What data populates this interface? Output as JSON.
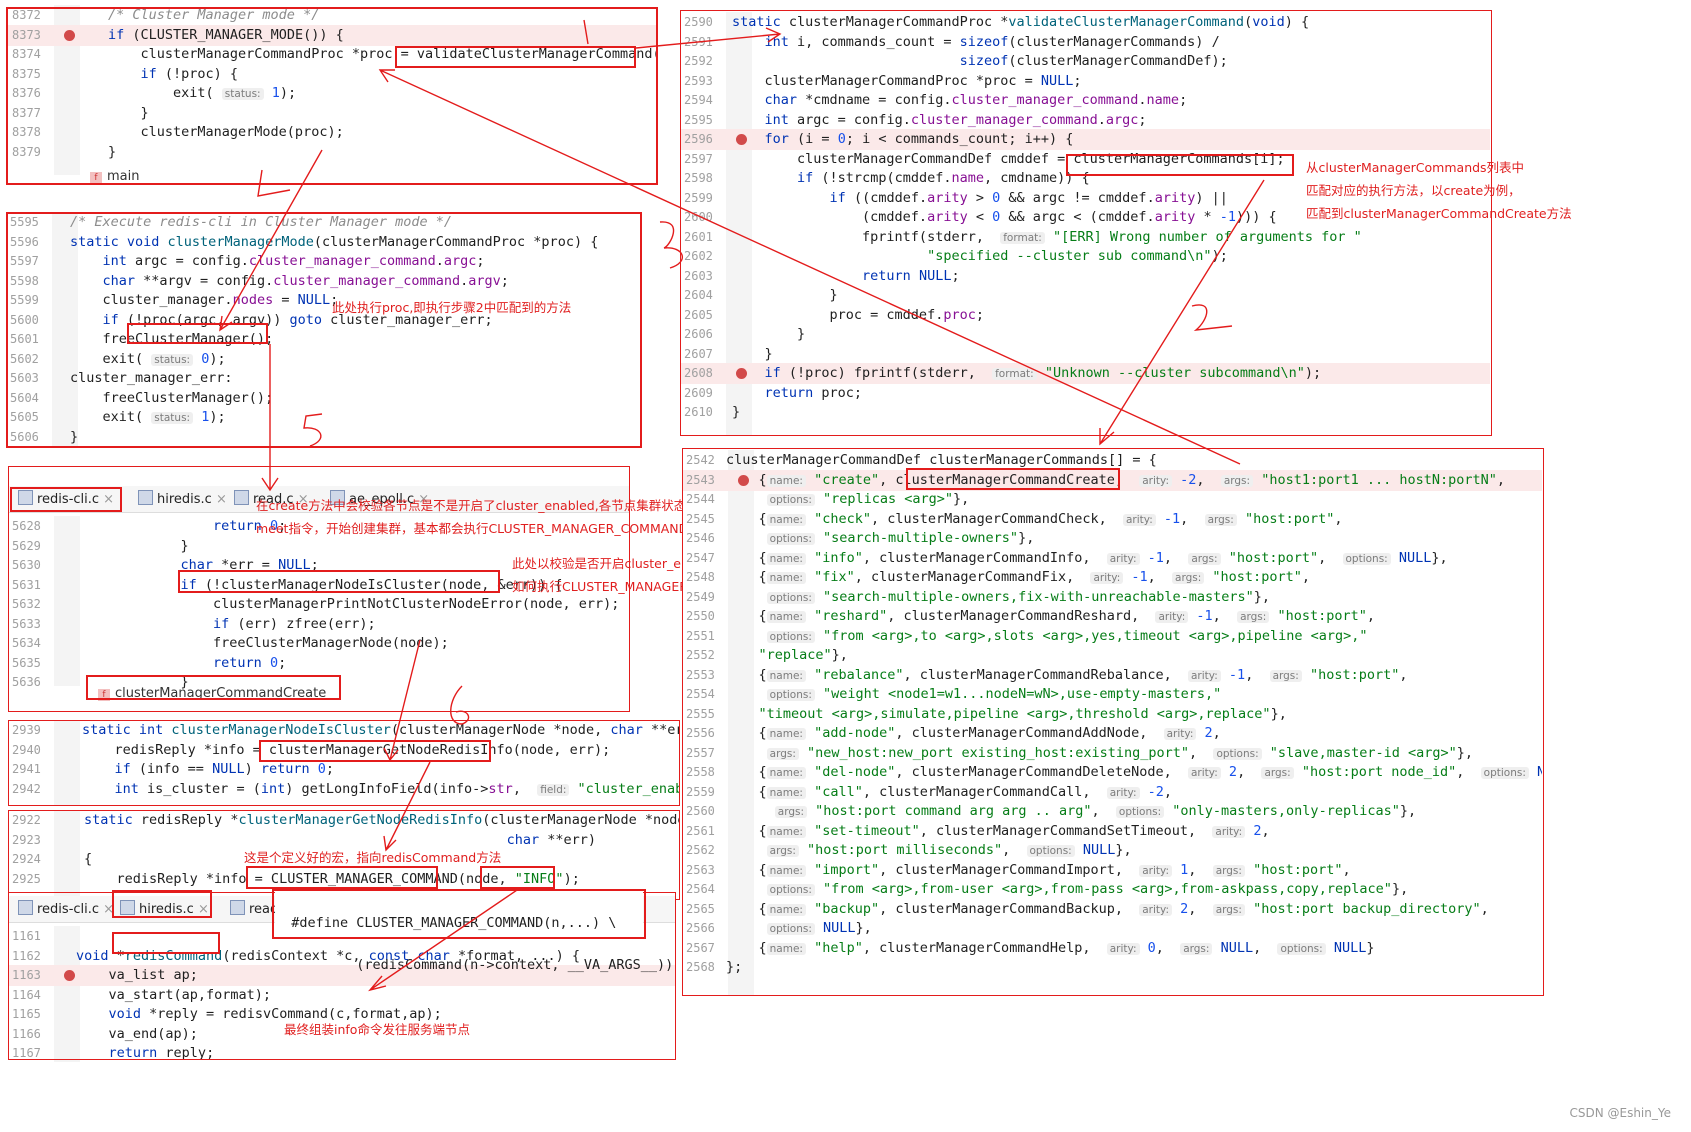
{
  "p1": {
    "lines": [
      {
        "n": "8372",
        "c": "<span class='cm'>/* Cluster Manager mode */</span>"
      },
      {
        "n": "8373",
        "c": "<span class='kw'>if</span> (CLUSTER_MANAGER_MODE()) {",
        "bp": true,
        "hl": true
      },
      {
        "n": "8374",
        "c": "    clusterManagerCommandProc *proc = validateClusterManagerCommand();"
      },
      {
        "n": "8375",
        "c": "    <span class='kw'>if</span> (!proc) {"
      },
      {
        "n": "8376",
        "c": "        exit( <span class='hint'>status:</span> <span class='num'>1</span>);"
      },
      {
        "n": "8377",
        "c": "    }"
      },
      {
        "n": "8378",
        "c": "    clusterManagerMode(proc);"
      },
      {
        "n": "8379",
        "c": "}"
      }
    ],
    "crumb": "main"
  },
  "p2": {
    "lines": [
      {
        "n": "5595",
        "c": "<span class='cm'>/* Execute redis-cli in Cluster Manager mode */</span>"
      },
      {
        "n": "5596",
        "c": "<span class='kw'>static void</span> <span class='fn'>clusterManagerMode</span>(clusterManagerCommandProc *proc) {"
      },
      {
        "n": "5597",
        "c": "    <span class='kw'>int</span> argc = config.<span class='fld'>cluster_manager_command</span>.<span class='fld'>argc</span>;"
      },
      {
        "n": "5598",
        "c": "    <span class='kw'>char</span> **argv = config.<span class='fld'>cluster_manager_command</span>.<span class='fld'>argv</span>;"
      },
      {
        "n": "5599",
        "c": "    cluster_manager.<span class='fld'>nodes</span> = <span class='kw'>NULL</span>;"
      },
      {
        "n": "5600",
        "c": "    <span class='kw'>if</span> (!proc(argc, argv)) <span class='kw'>goto</span> cluster_manager_err;"
      },
      {
        "n": "5601",
        "c": "    freeClusterManager();"
      },
      {
        "n": "5602",
        "c": "    exit( <span class='hint'>status:</span> <span class='num'>0</span>);"
      },
      {
        "n": "5603",
        "c": "cluster_manager_err:"
      },
      {
        "n": "5604",
        "c": "    freeClusterManager();"
      },
      {
        "n": "5605",
        "c": "    exit( <span class='hint'>status:</span> <span class='num'>1</span>);"
      },
      {
        "n": "5606",
        "c": "}"
      }
    ],
    "note": "此处执行proc,即执行步骤2中匹配到的方法"
  },
  "p3": {
    "tabs": [
      "redis-cli.c",
      "hiredis.c",
      "read.c",
      "ae_epoll.c"
    ],
    "lines": [
      {
        "n": "5628",
        "c": "        <span class='kw'>return</span> <span class='num'>0</span>;"
      },
      {
        "n": "5629",
        "c": "    }"
      },
      {
        "n": "5630",
        "c": "    <span class='kw'>char</span> *err = <span class='kw'>NULL</span>;"
      },
      {
        "n": "5631",
        "c": "    <span class='kw'>if</span> (!clusterManagerNodeIsCluster(node, &amp;err)) {"
      },
      {
        "n": "5632",
        "c": "        clusterManagerPrintNotClusterNodeError(node, err);"
      },
      {
        "n": "5633",
        "c": "        <span class='kw'>if</span> (err) zfree(err);"
      },
      {
        "n": "5634",
        "c": "        freeClusterManagerNode(node);"
      },
      {
        "n": "5635",
        "c": "        <span class='kw'>return</span> <span class='num'>0</span>;"
      },
      {
        "n": "5636",
        "c": "    }"
      }
    ],
    "crumb": "clusterManagerCommandCreate",
    "note1": "在create方法中会校验各节点是不是开启了cluster_enabled,各节点集群状态等，然后再通过\nmeet指令，开始创建集群，基本都会执行CLUSTER_MANAGER_COMMAND",
    "note2": "此处以校验是否开启cluster_enabled为例，了解\n如何执行CLUSTER_MANAGER_COMMAND"
  },
  "p4": {
    "lines": [
      {
        "n": "2939",
        "c": "<span class='kw'>static int</span> <span class='fn'>clusterManagerNodeIsCluster</span>(clusterManagerNode *node, <span class='kw'>char</span> **err) {"
      },
      {
        "n": "2940",
        "c": "    redisReply *info = clusterManagerGetNodeRedisInfo(node, err);"
      },
      {
        "n": "2941",
        "c": "    <span class='kw'>if</span> (info == <span class='kw'>NULL</span>) <span class='kw'>return</span> <span class='num'>0</span>;"
      },
      {
        "n": "2942",
        "c": "    <span class='kw'>int</span> is_cluster = (<span class='kw'>int</span>) getLongInfoField(info-&gt;<span class='fld'>str</span>,  <span class='hint'>field:</span> <span class='st'>\"cluster_enabled\"</span>);"
      }
    ]
  },
  "p5": {
    "lines": [
      {
        "n": "2922",
        "c": "<span class='kw'>static</span> redisReply *<span class='fn'>clusterManagerGetNodeRedisInfo</span>(clusterManagerNode *node,"
      },
      {
        "n": "2923",
        "c": "                                                    <span class='kw'>char</span> **err)"
      },
      {
        "n": "2924",
        "c": "{"
      },
      {
        "n": "2925",
        "c": "    redisReply *info = CLUSTER_MANAGER_COMMAND(node, <span class='st'>\"INFO\"</span>);"
      }
    ],
    "note": "这是个定义好的宏，指向redisCommand方法"
  },
  "p6": {
    "tabs": [
      "redis-cli.c",
      "hiredis.c",
      "read.c"
    ],
    "define1": "#define CLUSTER_MANAGER_COMMAND(n,...) \\",
    "define2": "        (redisCommand(n->context, __VA_ARGS__))",
    "lines": [
      {
        "n": "1161",
        "c": ""
      },
      {
        "n": "1162",
        "c": "<span class='kw'>void</span> *<span class='fn'>redisCommand</span>(redisContext *c, <span class='kw'>const char</span> *format, ...) {"
      },
      {
        "n": "1163",
        "c": "    va_list ap;",
        "bp": true,
        "hl": true
      },
      {
        "n": "1164",
        "c": "    va_start(ap,format);"
      },
      {
        "n": "1165",
        "c": "    <span class='kw'>void</span> *reply = redisvCommand(c,format,ap);"
      },
      {
        "n": "1166",
        "c": "    va_end(ap);"
      },
      {
        "n": "1167",
        "c": "    <span class='kw'>return</span> reply;"
      }
    ],
    "note": "最终组装info命令发往服务端节点"
  },
  "p7": {
    "lines": [
      {
        "n": "2590",
        "c": "<span class='kw'>static</span> clusterManagerCommandProc *<span class='fn'>validateClusterManagerCommand</span>(<span class='kw'>void</span>) {"
      },
      {
        "n": "2591",
        "c": "    <span class='kw'>int</span> i, commands_count = <span class='kw'>sizeof</span>(clusterManagerCommands) /"
      },
      {
        "n": "2592",
        "c": "                            <span class='kw'>sizeof</span>(clusterManagerCommandDef);"
      },
      {
        "n": "2593",
        "c": "    clusterManagerCommandProc *proc = <span class='kw'>NULL</span>;"
      },
      {
        "n": "2594",
        "c": "    <span class='kw'>char</span> *cmdname = config.<span class='fld'>cluster_manager_command</span>.<span class='fld'>name</span>;"
      },
      {
        "n": "2595",
        "c": "    <span class='kw'>int</span> argc = config.<span class='fld'>cluster_manager_command</span>.<span class='fld'>argc</span>;"
      },
      {
        "n": "2596",
        "c": "    <span class='kw'>for</span> (i = <span class='num'>0</span>; i &lt; commands_count; i++) {",
        "bp": true,
        "hl": true
      },
      {
        "n": "2597",
        "c": "        clusterManagerCommandDef cmddef = clusterManagerCommands[i];"
      },
      {
        "n": "2598",
        "c": "        <span class='kw'>if</span> (!strcmp(cmddef.<span class='fld'>name</span>, cmdname)) {"
      },
      {
        "n": "2599",
        "c": "            <span class='kw'>if</span> ((cmddef.<span class='fld'>arity</span> &gt; <span class='num'>0</span> &amp;&amp; argc != cmddef.<span class='fld'>arity</span>) ||"
      },
      {
        "n": "2600",
        "c": "                (cmddef.<span class='fld'>arity</span> &lt; <span class='num'>0</span> &amp;&amp; argc &lt; (cmddef.<span class='fld'>arity</span> * <span class='num'>-1</span>))) {"
      },
      {
        "n": "2601",
        "c": "                fprintf(stderr,  <span class='hint'>format:</span> <span class='st'>\"[ERR] Wrong number of arguments for \"</span>"
      },
      {
        "n": "2602",
        "c": "                        <span class='st'>\"specified --cluster sub command\\n\"</span>);"
      },
      {
        "n": "2603",
        "c": "                <span class='kw'>return</span> <span class='kw'>NULL</span>;"
      },
      {
        "n": "2604",
        "c": "            }"
      },
      {
        "n": "2605",
        "c": "            proc = cmddef.<span class='fld'>proc</span>;"
      },
      {
        "n": "2606",
        "c": "        }"
      },
      {
        "n": "2607",
        "c": "    }"
      },
      {
        "n": "2608",
        "c": "    <span class='kw'>if</span> (!proc) fprintf(stderr,  <span class='hint'>format:</span> <span class='st'>\"Unknown --cluster subcommand\\n\"</span>);",
        "bp": true,
        "hl": true
      },
      {
        "n": "2609",
        "c": "    <span class='kw'>return</span> proc;"
      },
      {
        "n": "2610",
        "c": "}"
      }
    ],
    "note": "从clusterManagerCommands列表中\n匹配对应的执行方法，以create为例，\n匹配到clusterManagerCommandCreate方法"
  },
  "p8": {
    "lines": [
      {
        "n": "2542",
        "c": "clusterManagerCommandDef clusterManagerCommands[] = {"
      },
      {
        "n": "2543",
        "c": "    {<span class='hint'>name:</span> <span class='st'>\"create\"</span>, clusterManagerCommandCreate,  <span class='hint'>arity:</span> <span class='num'>-2</span>,  <span class='hint'>args:</span> <span class='st'>\"host1:port1 ... hostN:portN\"</span>,",
        "bp": true,
        "hl": true
      },
      {
        "n": "2544",
        "c": "     <span class='hint'>options:</span> <span class='st'>\"replicas &lt;arg&gt;\"</span>},"
      },
      {
        "n": "2545",
        "c": "    {<span class='hint'>name:</span> <span class='st'>\"check\"</span>, clusterManagerCommandCheck,  <span class='hint'>arity:</span> <span class='num'>-1</span>,  <span class='hint'>args:</span> <span class='st'>\"host:port\"</span>,"
      },
      {
        "n": "2546",
        "c": "     <span class='hint'>options:</span> <span class='st'>\"search-multiple-owners\"</span>},"
      },
      {
        "n": "2547",
        "c": "    {<span class='hint'>name:</span> <span class='st'>\"info\"</span>, clusterManagerCommandInfo,  <span class='hint'>arity:</span> <span class='num'>-1</span>,  <span class='hint'>args:</span> <span class='st'>\"host:port\"</span>,  <span class='hint'>options:</span> <span class='kw'>NULL</span>},"
      },
      {
        "n": "2548",
        "c": "    {<span class='hint'>name:</span> <span class='st'>\"fix\"</span>, clusterManagerCommandFix,  <span class='hint'>arity:</span> <span class='num'>-1</span>,  <span class='hint'>args:</span> <span class='st'>\"host:port\"</span>,"
      },
      {
        "n": "2549",
        "c": "     <span class='hint'>options:</span> <span class='st'>\"search-multiple-owners,fix-with-unreachable-masters\"</span>},"
      },
      {
        "n": "2550",
        "c": "    {<span class='hint'>name:</span> <span class='st'>\"reshard\"</span>, clusterManagerCommandReshard,  <span class='hint'>arity:</span> <span class='num'>-1</span>,  <span class='hint'>args:</span> <span class='st'>\"host:port\"</span>,"
      },
      {
        "n": "2551",
        "c": "     <span class='hint'>options:</span> <span class='st'>\"from &lt;arg&gt;,to &lt;arg&gt;,slots &lt;arg&gt;,yes,timeout &lt;arg&gt;,pipeline &lt;arg&gt;,\"</span>"
      },
      {
        "n": "2552",
        "c": "    <span class='st'>\"replace\"</span>},"
      },
      {
        "n": "2553",
        "c": "    {<span class='hint'>name:</span> <span class='st'>\"rebalance\"</span>, clusterManagerCommandRebalance,  <span class='hint'>arity:</span> <span class='num'>-1</span>,  <span class='hint'>args:</span> <span class='st'>\"host:port\"</span>,"
      },
      {
        "n": "2554",
        "c": "     <span class='hint'>options:</span> <span class='st'>\"weight &lt;node1=w1...nodeN=wN&gt;,use-empty-masters,\"</span>"
      },
      {
        "n": "2555",
        "c": "    <span class='st'>\"timeout &lt;arg&gt;,simulate,pipeline &lt;arg&gt;,threshold &lt;arg&gt;,replace\"</span>},"
      },
      {
        "n": "2556",
        "c": "    {<span class='hint'>name:</span> <span class='st'>\"add-node\"</span>, clusterManagerCommandAddNode,  <span class='hint'>arity:</span> <span class='num'>2</span>,"
      },
      {
        "n": "2557",
        "c": "     <span class='hint'>args:</span> <span class='st'>\"new_host:new_port existing_host:existing_port\"</span>,  <span class='hint'>options:</span> <span class='st'>\"slave,master-id &lt;arg&gt;\"</span>},"
      },
      {
        "n": "2558",
        "c": "    {<span class='hint'>name:</span> <span class='st'>\"del-node\"</span>, clusterManagerCommandDeleteNode,  <span class='hint'>arity:</span> <span class='num'>2</span>,  <span class='hint'>args:</span> <span class='st'>\"host:port node_id\"</span>,  <span class='hint'>options:</span> <span class='kw'>NULL</span>},"
      },
      {
        "n": "2559",
        "c": "    {<span class='hint'>name:</span> <span class='st'>\"call\"</span>, clusterManagerCommandCall,  <span class='hint'>arity:</span> <span class='num'>-2</span>,"
      },
      {
        "n": "2560",
        "c": "      <span class='hint'>args:</span> <span class='st'>\"host:port command arg arg .. arg\"</span>,  <span class='hint'>options:</span> <span class='st'>\"only-masters,only-replicas\"</span>},"
      },
      {
        "n": "2561",
        "c": "    {<span class='hint'>name:</span> <span class='st'>\"set-timeout\"</span>, clusterManagerCommandSetTimeout,  <span class='hint'>arity:</span> <span class='num'>2</span>,"
      },
      {
        "n": "2562",
        "c": "     <span class='hint'>args:</span> <span class='st'>\"host:port milliseconds\"</span>,  <span class='hint'>options:</span> <span class='kw'>NULL</span>},"
      },
      {
        "n": "2563",
        "c": "    {<span class='hint'>name:</span> <span class='st'>\"import\"</span>, clusterManagerCommandImport,  <span class='hint'>arity:</span> <span class='num'>1</span>,  <span class='hint'>args:</span> <span class='st'>\"host:port\"</span>,"
      },
      {
        "n": "2564",
        "c": "     <span class='hint'>options:</span> <span class='st'>\"from &lt;arg&gt;,from-user &lt;arg&gt;,from-pass &lt;arg&gt;,from-askpass,copy,replace\"</span>},"
      },
      {
        "n": "2565",
        "c": "    {<span class='hint'>name:</span> <span class='st'>\"backup\"</span>, clusterManagerCommandBackup,  <span class='hint'>arity:</span> <span class='num'>2</span>,  <span class='hint'>args:</span> <span class='st'>\"host:port backup_directory\"</span>,"
      },
      {
        "n": "2566",
        "c": "     <span class='hint'>options:</span> <span class='kw'>NULL</span>},"
      },
      {
        "n": "2567",
        "c": "    {<span class='hint'>name:</span> <span class='st'>\"help\"</span>, clusterManagerCommandHelp,  <span class='hint'>arity:</span> <span class='num'>0</span>,  <span class='hint'>args:</span> <span class='kw'>NULL</span>,  <span class='hint'>options:</span> <span class='kw'>NULL</span>}"
      },
      {
        "n": "2568",
        "c": "};"
      }
    ]
  },
  "watermark": "CSDN @Eshin_Ye",
  "accent": "#e31c1c"
}
